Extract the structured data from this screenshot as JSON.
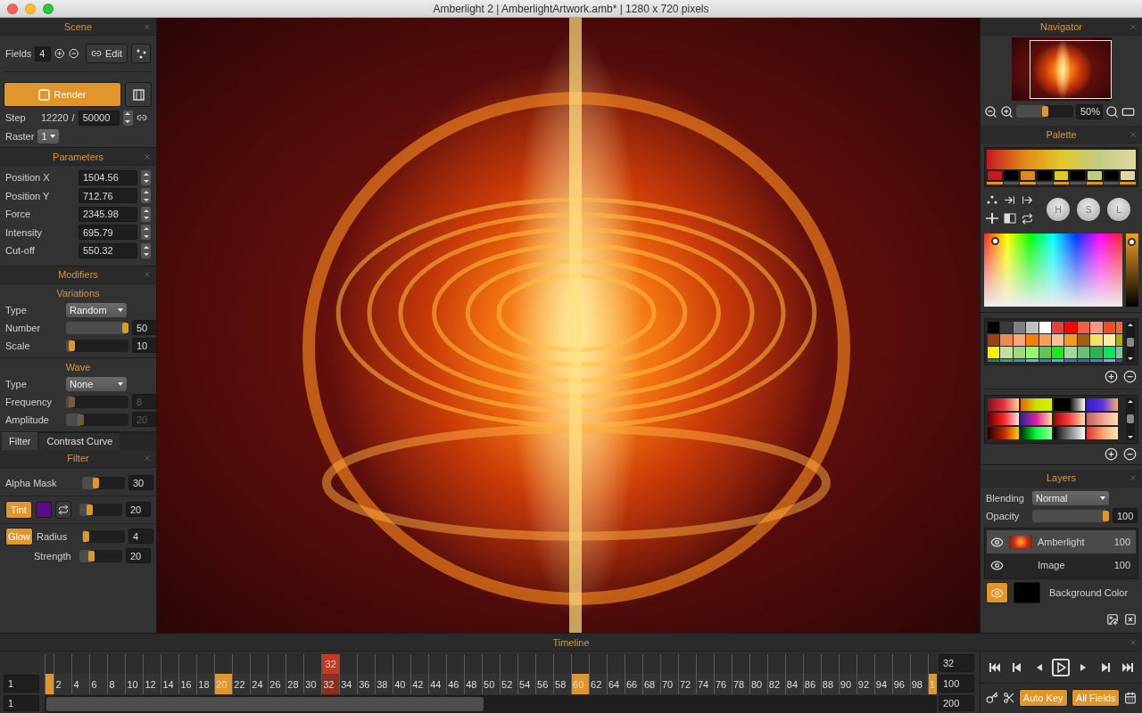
{
  "window": {
    "title": "Amberlight 2 | AmberlightArtwork.amb* | 1280 x 720 pixels"
  },
  "scene": {
    "title": "Scene",
    "fields_label": "Fields",
    "fields_value": "4",
    "edit_label": "Edit",
    "render_label": "Render",
    "step_label": "Step",
    "step_current": "12220",
    "step_separator": "/",
    "step_total": "50000",
    "raster_label": "Raster",
    "raster_value": "1"
  },
  "parameters": {
    "title": "Parameters",
    "rows": [
      {
        "label": "Position X",
        "value": "1504.56"
      },
      {
        "label": "Position Y",
        "value": "712.76"
      },
      {
        "label": "Force",
        "value": "2345.98"
      },
      {
        "label": "Intensity",
        "value": "695.79"
      },
      {
        "label": "Cut-off",
        "value": "550.32"
      }
    ]
  },
  "modifiers": {
    "title": "Modifiers",
    "sections": [
      {
        "title": "Variations",
        "rows": [
          {
            "kind": "dropdown",
            "label": "Type",
            "value": "Random"
          },
          {
            "kind": "slider",
            "label": "Number",
            "level": 1.0,
            "value": "50",
            "disabled": false
          },
          {
            "kind": "slider",
            "label": "Scale",
            "level": 0.05,
            "value": "10",
            "disabled": false
          }
        ]
      },
      {
        "title": "Wave",
        "rows": [
          {
            "kind": "dropdown",
            "label": "Type",
            "value": "None"
          },
          {
            "kind": "slider",
            "label": "Frequency",
            "level": 0.05,
            "value": "8",
            "disabled": true
          },
          {
            "kind": "slider",
            "label": "Amplitude",
            "level": 0.2,
            "value": "20",
            "disabled": true
          }
        ]
      }
    ]
  },
  "filter_tabs": [
    {
      "label": "Filter",
      "selected": true
    },
    {
      "label": "Contrast Curve",
      "selected": false
    }
  ],
  "filter": {
    "title": "Filter",
    "rows": [
      {
        "kind": "slider",
        "label": "Alpha Mask",
        "level": 0.3,
        "value": "30"
      },
      {
        "kind": "tint",
        "toggle": "Tint",
        "on": true,
        "color": "#5a0c8c",
        "level": 0.2,
        "value": "20"
      },
      {
        "kind": "toggle",
        "toggle": "Glow",
        "on": true,
        "label": "Radius",
        "level": 0.03,
        "value": "4"
      },
      {
        "kind": "sub",
        "label": "Strength",
        "level": 0.25,
        "value": "20"
      }
    ]
  },
  "navigator": {
    "title": "Navigator",
    "zoom": {
      "level": 0.5,
      "value": "50%"
    }
  },
  "palette": {
    "title": "Palette",
    "stops": [
      {
        "color": "#c81820",
        "marked": true
      },
      {
        "color": "#000000",
        "marked": false
      },
      {
        "color": "#e08818",
        "marked": true
      },
      {
        "color": "#000000",
        "marked": false
      },
      {
        "color": "#e0c828",
        "marked": true
      },
      {
        "color": "#000000",
        "marked": false
      },
      {
        "color": "#c0cc80",
        "marked": true
      },
      {
        "color": "#000000",
        "marked": false
      },
      {
        "color": "#e0d8a0",
        "marked": true
      }
    ],
    "knobs": [
      "H",
      "S",
      "L"
    ],
    "swatches": [
      {
        "color": "#000000"
      },
      {
        "color": "#3a3a3a"
      },
      {
        "color": "#808080"
      },
      {
        "color": "#c0c0c0"
      },
      {
        "color": "#ffffff"
      },
      {
        "color": "#e84040"
      },
      {
        "color": "#ff0000"
      },
      {
        "color": "#f06048"
      },
      {
        "color": "#f89880"
      },
      {
        "color": "#f05020"
      },
      {
        "color": "#f06830"
      },
      {
        "color": "#a04010"
      },
      {
        "color": "#f08850"
      },
      {
        "color": "#f8a878"
      },
      {
        "color": "#f88000"
      },
      {
        "color": "#f8a050"
      },
      {
        "color": "#f8c090"
      },
      {
        "color": "#f89820"
      },
      {
        "color": "#a06010"
      },
      {
        "color": "#f8e060"
      },
      {
        "color": "#f8f0a0"
      },
      {
        "color": "#b8a800"
      },
      {
        "color": "#f8f000"
      },
      {
        "color": "#c0e0a0"
      },
      {
        "color": "#a0d880"
      },
      {
        "color": "#98f868"
      },
      {
        "color": "#60c850"
      },
      {
        "color": "#10f010"
      },
      {
        "color": "#a0d8a0"
      },
      {
        "color": "#68c078"
      },
      {
        "color": "#30b050"
      },
      {
        "color": "#00e860"
      },
      {
        "color": "#78c898"
      },
      {
        "color": "#208060"
      },
      {
        "color": "#40a070"
      },
      {
        "color": "#20a0a0"
      },
      {
        "color": "#60c0c0"
      },
      {
        "color": "#2090b0"
      },
      {
        "color": "#30c0e0"
      },
      {
        "color": "#2080c0"
      },
      {
        "color": "#3070a0"
      },
      {
        "color": "#2090d0"
      },
      {
        "color": "#70b0e0"
      },
      {
        "color": "#2060a0"
      }
    ],
    "lightness": {
      "level": 0.17
    }
  },
  "layers": {
    "title": "Layers",
    "blending_label": "Blending",
    "blending_value": "Normal",
    "opacity": {
      "label": "Opacity",
      "level": 1.0,
      "value": "100"
    },
    "items": [
      {
        "kind": "render",
        "name": "Amberlight",
        "value": "100",
        "selected": true,
        "visible": true
      },
      {
        "kind": "image",
        "name": "Image",
        "value": "100",
        "selected": false,
        "visible": true
      }
    ],
    "background": {
      "label": "Background Color",
      "on": true,
      "color": "#000000"
    }
  },
  "timeline": {
    "title": "Timeline",
    "current_marker": "32",
    "left_fields": [
      "1",
      "1"
    ],
    "right_fields": [
      "32",
      "100",
      "200"
    ],
    "frames": [
      {
        "keyframe": true,
        "current": false
      },
      {
        "label": "2",
        "keyframe": false,
        "current": false
      },
      {
        "label": "4",
        "keyframe": false,
        "current": false
      },
      {
        "label": "6",
        "keyframe": false,
        "current": false
      },
      {
        "label": "8",
        "keyframe": false,
        "current": false
      },
      {
        "label": "10",
        "keyframe": false,
        "current": false
      },
      {
        "label": "12",
        "keyframe": false,
        "current": false
      },
      {
        "label": "14",
        "keyframe": false,
        "current": false
      },
      {
        "label": "16",
        "keyframe": false,
        "current": false
      },
      {
        "label": "18",
        "keyframe": false,
        "current": false
      },
      {
        "label": "20",
        "keyframe": true,
        "current": false
      },
      {
        "label": "22",
        "keyframe": false,
        "current": false
      },
      {
        "label": "24",
        "keyframe": false,
        "current": false
      },
      {
        "label": "26",
        "keyframe": false,
        "current": false
      },
      {
        "label": "28",
        "keyframe": false,
        "current": false
      },
      {
        "label": "30",
        "keyframe": false,
        "current": false
      },
      {
        "label": "32",
        "keyframe": false,
        "current": true
      },
      {
        "label": "34",
        "keyframe": false,
        "current": false
      },
      {
        "label": "36",
        "keyframe": false,
        "current": false
      },
      {
        "label": "38",
        "keyframe": false,
        "current": false
      },
      {
        "label": "40",
        "keyframe": false,
        "current": false
      },
      {
        "label": "42",
        "keyframe": false,
        "current": false
      },
      {
        "label": "44",
        "keyframe": false,
        "current": false
      },
      {
        "label": "46",
        "keyframe": false,
        "current": false
      },
      {
        "label": "48",
        "keyframe": false,
        "current": false
      },
      {
        "label": "50",
        "keyframe": false,
        "current": false
      },
      {
        "label": "52",
        "keyframe": false,
        "current": false
      },
      {
        "label": "54",
        "keyframe": false,
        "current": false
      },
      {
        "label": "56",
        "keyframe": false,
        "current": false
      },
      {
        "label": "58",
        "keyframe": false,
        "current": false
      },
      {
        "label": "60",
        "keyframe": true,
        "current": false
      },
      {
        "label": "62",
        "keyframe": false,
        "current": false
      },
      {
        "label": "64",
        "keyframe": false,
        "current": false
      },
      {
        "label": "66",
        "keyframe": false,
        "current": false
      },
      {
        "label": "68",
        "keyframe": false,
        "current": false
      },
      {
        "label": "70",
        "keyframe": false,
        "current": false
      },
      {
        "label": "72",
        "keyframe": false,
        "current": false
      },
      {
        "label": "74",
        "keyframe": false,
        "current": false
      },
      {
        "label": "76",
        "keyframe": false,
        "current": false
      },
      {
        "label": "78",
        "keyframe": false,
        "current": false
      },
      {
        "label": "80",
        "keyframe": false,
        "current": false
      },
      {
        "label": "82",
        "keyframe": false,
        "current": false
      },
      {
        "label": "84",
        "keyframe": false,
        "current": false
      },
      {
        "label": "86",
        "keyframe": false,
        "current": false
      },
      {
        "label": "88",
        "keyframe": false,
        "current": false
      },
      {
        "label": "90",
        "keyframe": false,
        "current": false
      },
      {
        "label": "92",
        "keyframe": false,
        "current": false
      },
      {
        "label": "94",
        "keyframe": false,
        "current": false
      },
      {
        "label": "96",
        "keyframe": false,
        "current": false
      },
      {
        "label": "98",
        "keyframe": false,
        "current": false
      },
      {
        "label": "1",
        "keyframe": true,
        "current": false
      }
    ],
    "transport": [
      {
        "kind": "first",
        "selected": false
      },
      {
        "kind": "prev",
        "selected": false
      },
      {
        "kind": "back",
        "selected": false
      },
      {
        "kind": "play",
        "selected": true
      },
      {
        "kind": "forward",
        "selected": false
      },
      {
        "kind": "next",
        "selected": false
      },
      {
        "kind": "last",
        "selected": false
      }
    ],
    "auto_key": {
      "label": "Auto Key",
      "on": true
    },
    "all_fields": {
      "label": "All Fields",
      "on": true
    }
  }
}
